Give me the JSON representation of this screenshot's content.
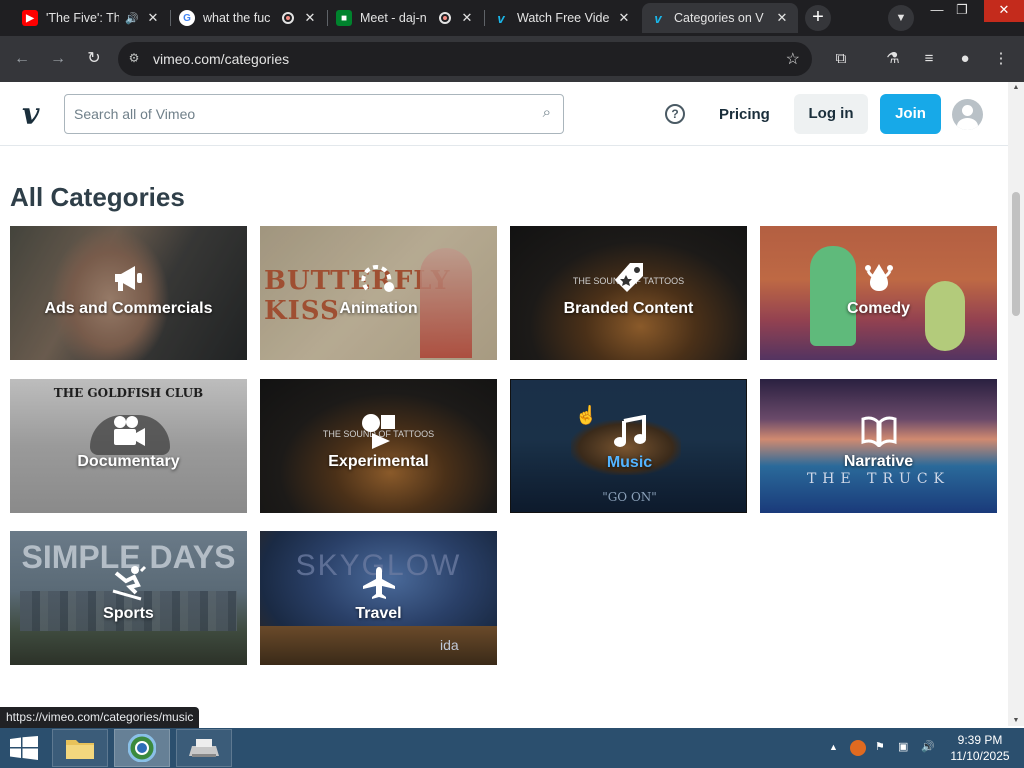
{
  "browser": {
    "tabs": [
      {
        "title": "'The Five': Th",
        "favicon": "youtube-icon",
        "fav_color": "#ff0000"
      },
      {
        "title": "what the fuc",
        "favicon": "google-icon",
        "fav_color": "#ffffff"
      },
      {
        "title": "Meet - daj-n",
        "favicon": "meet-icon",
        "fav_color": "#00832d"
      },
      {
        "title": "Watch Free Vide",
        "favicon": "vimeo-icon",
        "fav_color": "#1ab7ea"
      },
      {
        "title": "Categories on V",
        "favicon": "vimeo-icon",
        "fav_color": "#1ab7ea"
      }
    ],
    "url": "vimeo.com/categories",
    "status_url": "https://vimeo.com/categories/music"
  },
  "header": {
    "search_placeholder": "Search all of Vimeo",
    "pricing": "Pricing",
    "login": "Log in",
    "join": "Join",
    "join_color": "#17a9e8"
  },
  "page": {
    "heading": "All Categories"
  },
  "categories": [
    {
      "label": "Ads and Commercials",
      "icon": "megaphone-icon"
    },
    {
      "label": "Animation",
      "icon": "animation-icon"
    },
    {
      "label": "Branded Content",
      "icon": "tag-icon"
    },
    {
      "label": "Comedy",
      "icon": "jester-hat-icon"
    },
    {
      "label": "Documentary",
      "icon": "video-camera-icon"
    },
    {
      "label": "Experimental",
      "icon": "shapes-icon"
    },
    {
      "label": "Music",
      "icon": "music-note-icon"
    },
    {
      "label": "Narrative",
      "icon": "book-icon"
    },
    {
      "label": "Sports",
      "icon": "skier-icon"
    },
    {
      "label": "Travel",
      "icon": "airplane-icon"
    }
  ],
  "thumb_text": {
    "butterfly": "BUTTERFLY KISS",
    "tattoos": "THE SOUND OF TATTOOS",
    "goldfish": "THE GOLDFISH CLUB",
    "go_on": "\"GO ON\"",
    "truck": "THE TRUCK",
    "simple_days": "SIMPLE DAYS",
    "skyglow": "SKYGLOW",
    "ida": "ida"
  },
  "taskbar": {
    "time": "9:39 PM",
    "date": "11/10/2025"
  }
}
